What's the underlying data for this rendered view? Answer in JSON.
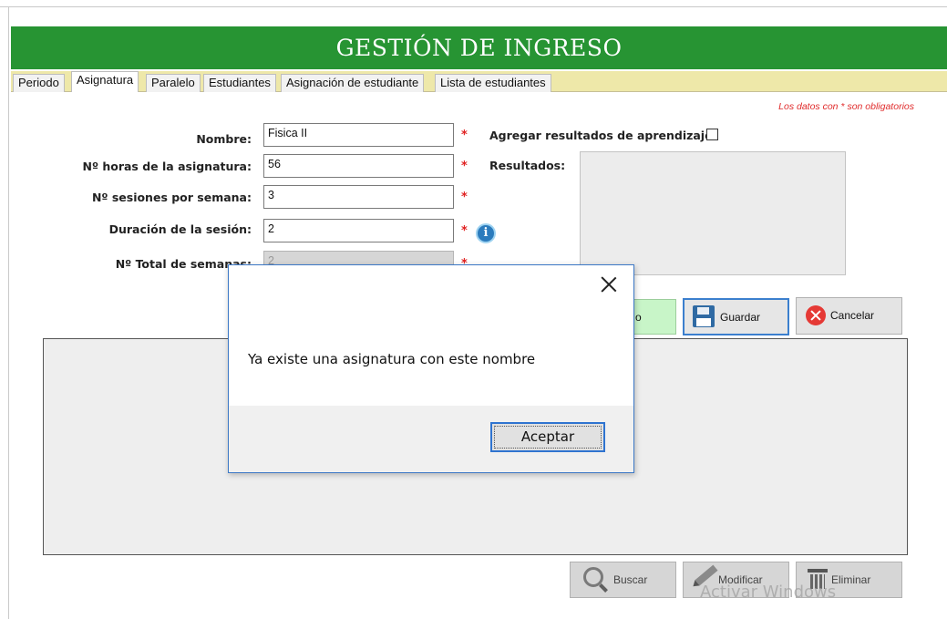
{
  "header": {
    "title": "GESTIÓN DE INGRESO"
  },
  "tabs": [
    {
      "label": "Periodo"
    },
    {
      "label": "Asignatura",
      "active": true
    },
    {
      "label": "Paralelo"
    },
    {
      "label": "Estudiantes"
    },
    {
      "label": "Asignación de estudiante"
    },
    {
      "label": "Lista de estudiantes"
    }
  ],
  "form": {
    "required_note": "Los datos con * son obligatorios",
    "required_mark": "*",
    "nombre": {
      "label": "Nombre:",
      "value": "Fisica II"
    },
    "horas": {
      "label": "Nº horas de la asignatura:",
      "value": "56"
    },
    "sesiones": {
      "label": "Nº sesiones por semana:",
      "value": "3"
    },
    "duracion": {
      "label": "Duración de la sesión:",
      "value": "2"
    },
    "total_semanas": {
      "label": "Nº Total de semanas:",
      "value": "2"
    },
    "agregar_resultados": {
      "label": "Agregar resultados de aprendizaje:",
      "checked": false
    },
    "resultados": {
      "label": "Resultados:"
    }
  },
  "buttons": {
    "green_partial": "o",
    "guardar": "Guardar",
    "cancelar": "Cancelar",
    "buscar": "Buscar",
    "modificar": "Modificar",
    "eliminar": "Eliminar"
  },
  "watermark": "Activar Windows",
  "dialog": {
    "message": "Ya existe una asignatura con este nombre",
    "ok_label": "Aceptar"
  },
  "icons": {
    "info": "info-icon",
    "save": "floppy-disk-icon",
    "cancel": "x-circle-icon",
    "search": "magnifier-icon",
    "edit": "pencil-icon",
    "delete": "trash-icon",
    "close": "close-icon"
  },
  "colors": {
    "header_green": "#279433",
    "tabbar_yellow": "#eee8a9",
    "required_red": "#e02020",
    "save_green": "#c8f5c8",
    "focus_blue": "#3b7fce"
  }
}
